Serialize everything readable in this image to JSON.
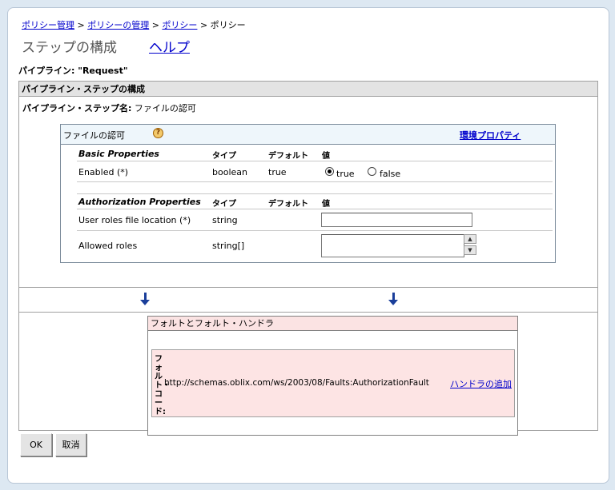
{
  "breadcrumb": {
    "items": [
      "ポリシー管理",
      "ポリシーの管理",
      "ポリシー"
    ],
    "current": "ポリシー",
    "separator": ">"
  },
  "page": {
    "title": "ステップの構成",
    "help_link": "ヘルプ",
    "pipeline_label": "パイプライン: \"Request\""
  },
  "config_box": {
    "title": "パイプライン・ステップの構成",
    "step_name_label": "パイプライン・ステップ名:",
    "step_name_value": "ファイルの認可"
  },
  "properties": {
    "title": "ファイルの認可",
    "help_icon": "question-icon",
    "env_link": "環境プロパティ",
    "basic": {
      "section": "Basic Properties",
      "col_type": "タイプ",
      "col_default": "デフォルト",
      "col_value": "値",
      "rows": [
        {
          "name": "Enabled (*)",
          "type": "boolean",
          "default": "true",
          "options": [
            "true",
            "false"
          ],
          "selected": "true"
        }
      ]
    },
    "auth": {
      "section": "Authorization Properties",
      "col_type": "タイプ",
      "col_default": "デフォルト",
      "col_value": "値",
      "rows": [
        {
          "name": "User roles file location (*)",
          "type": "string",
          "value": ""
        },
        {
          "name": "Allowed roles",
          "type": "string[]",
          "value": ""
        }
      ]
    }
  },
  "faults": {
    "title": "フォルトとフォルト・ハンドラ",
    "code_label": "フォルト・コード:",
    "code_value": "http://schemas.oblix.com/ws/2003/08/Faults:AuthorizationFault",
    "add_handler": "ハンドラの追加"
  },
  "buttons": {
    "ok": "OK",
    "cancel": "取消"
  },
  "colors": {
    "link": "#0000cc",
    "arrow": "#1a3e9a",
    "fault_bg": "#fde4e4",
    "props_header_bg": "#eef6fb"
  }
}
